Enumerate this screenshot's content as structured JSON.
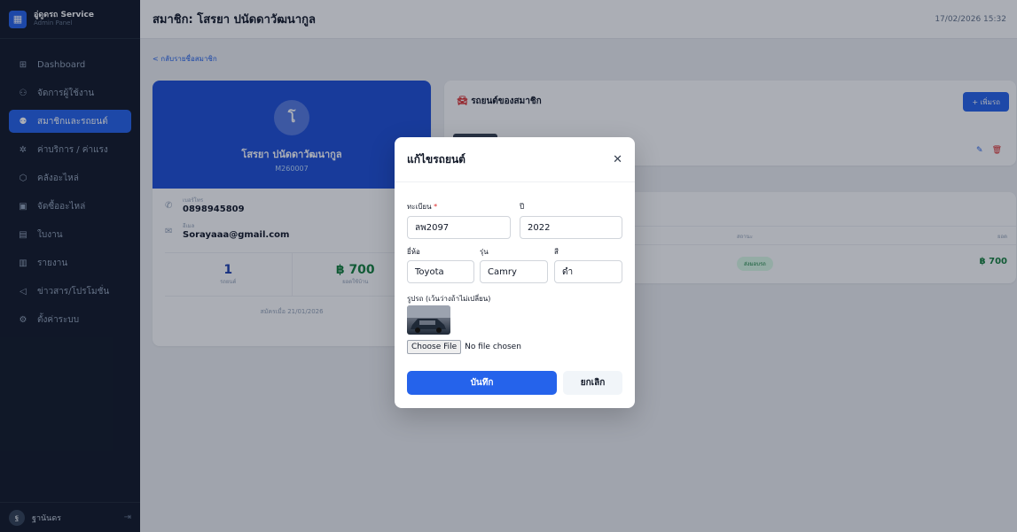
{
  "brand": {
    "name": "อู่ดูดรถ Service",
    "subtitle": "Admin Panel"
  },
  "sidebar": {
    "items": [
      {
        "label": "Dashboard",
        "icon": "grid-icon",
        "active": false
      },
      {
        "label": "จัดการผู้ใช้งาน",
        "icon": "user-icon",
        "active": false
      },
      {
        "label": "สมาชิกและรถยนต์",
        "icon": "users-icon",
        "active": true
      },
      {
        "label": "ค่าบริการ / ค่าแรง",
        "icon": "wrench-icon",
        "active": false
      },
      {
        "label": "คลังอะไหล่",
        "icon": "box-icon",
        "active": false
      },
      {
        "label": "จัดซื้ออะไหล่",
        "icon": "cart-icon",
        "active": false
      },
      {
        "label": "ใบงาน",
        "icon": "clipboard-icon",
        "active": false
      },
      {
        "label": "รายงาน",
        "icon": "chart-icon",
        "active": false
      },
      {
        "label": "ข่าวสาร/โปรโมชั่น",
        "icon": "megaphone-icon",
        "active": false
      },
      {
        "label": "ตั้งค่าระบบ",
        "icon": "gear-icon",
        "active": false
      }
    ],
    "user": {
      "initial": "ฐ",
      "name": "ฐานันดร"
    }
  },
  "header": {
    "title": "สมาชิก: โสรยา ปนัดดาวัฒนากูล",
    "datetime": "17/02/2026 15:32"
  },
  "main": {
    "back_link": "< กลับรายชื่อสมาชิก",
    "profile": {
      "initial": "โ",
      "name": "โสรยา ปนัดดาวัฒนากูล",
      "code": "M260007",
      "phone_label": "เบอร์โทร",
      "phone": "0898945809",
      "email_label": "อีเมล",
      "email": "Sorayaaa@gmail.com",
      "stats": [
        {
          "value": "1",
          "label": "รถยนต์"
        },
        {
          "value": "฿ 700",
          "label": "ยอดใช้บ้าน"
        }
      ],
      "member_since": "สมัครเมื่อ 21/01/2026"
    },
    "cars": {
      "title": "รถยนต์ของสมาชิก",
      "add_button": "+ เพิ่มรถ"
    },
    "history": {
      "col_status": "สถานะ",
      "col_price": "ยอด",
      "status": "ส่งมอบรถ",
      "price": "฿ 700"
    }
  },
  "modal": {
    "title": "แก้ไขรถยนต์",
    "plate_label": "ทะเบียน",
    "plate_required": "*",
    "plate_value": "ลพ2097",
    "year_label": "ปี",
    "year_value": "2022",
    "brand_label": "ยี่ห้อ",
    "brand_value": "Toyota",
    "model_label": "รุ่น",
    "model_value": "Camry",
    "color_label": "สี",
    "color_value": "ดำ",
    "photo_label": "รูปรถ (เว้นว่างถ้าไม่เปลี่ยน)",
    "choose_file": "Choose File",
    "no_file": "No file chosen",
    "save": "บันทึก",
    "cancel": "ยกเลิก"
  }
}
